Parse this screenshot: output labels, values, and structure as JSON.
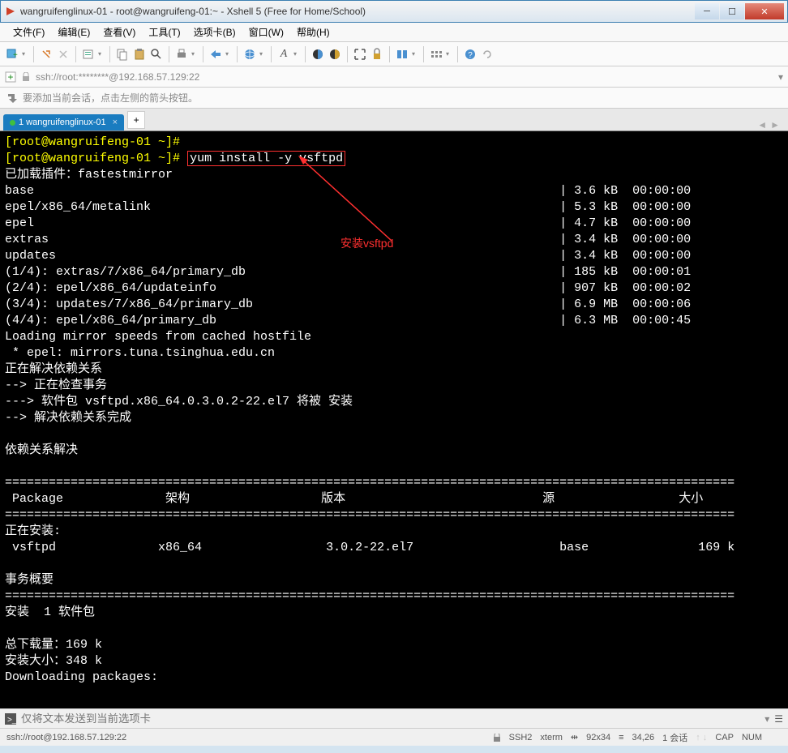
{
  "window": {
    "title": "wangruifenglinux-01 - root@wangruifeng-01:~ - Xshell 5 (Free for Home/School)"
  },
  "menu": {
    "file": "文件(F)",
    "edit": "编辑(E)",
    "view": "查看(V)",
    "tools": "工具(T)",
    "tab": "选项卡(B)",
    "window": "窗口(W)",
    "help": "帮助(H)"
  },
  "address": {
    "text": "ssh://root:********@192.168.57.129:22"
  },
  "info": {
    "text": "要添加当前会话，点击左侧的箭头按钮。"
  },
  "tab": {
    "label": "1 wangruifenglinux-01"
  },
  "terminal": {
    "prompt1": "[root@wangruifeng-01 ~]#",
    "prompt2": "[root@wangruifeng-01 ~]#",
    "command": "yum install -y vsftpd",
    "line_plugins": "已加载插件：fastestmirror",
    "repos": [
      {
        "name": "base",
        "size": "3.6 kB",
        "time": "00:00:00"
      },
      {
        "name": "epel/x86_64/metalink",
        "size": "5.3 kB",
        "time": "00:00:00"
      },
      {
        "name": "epel",
        "size": "4.7 kB",
        "time": "00:00:00"
      },
      {
        "name": "extras",
        "size": "3.4 kB",
        "time": "00:00:00"
      },
      {
        "name": "updates",
        "size": "3.4 kB",
        "time": "00:00:00"
      }
    ],
    "downloads": [
      {
        "idx": "(1/4): extras/7/x86_64/primary_db",
        "size": "185 kB",
        "time": "00:00:01"
      },
      {
        "idx": "(2/4): epel/x86_64/updateinfo",
        "size": "907 kB",
        "time": "00:00:02"
      },
      {
        "idx": "(3/4): updates/7/x86_64/primary_db",
        "size": "6.9 MB",
        "time": "00:00:06"
      },
      {
        "idx": "(4/4): epel/x86_64/primary_db",
        "size": "6.3 MB",
        "time": "00:00:45"
      }
    ],
    "loading_mirrors": "Loading mirror speeds from cached hostfile",
    "epel_mirror": " * epel: mirrors.tuna.tsinghua.edu.cn",
    "resolving": "正在解决依赖关系",
    "check_trans": "--> 正在检查事务",
    "pkg_install": "---> 软件包 vsftpd.x86_64.0.3.0.2-22.el7 将被 安装",
    "dep_done": "--> 解决依赖关系完成",
    "dep_resolved": "依赖关系解决",
    "hdr_package": " Package",
    "hdr_arch": "架构",
    "hdr_version": "版本",
    "hdr_repo": "源",
    "hdr_size": "大小",
    "installing": "正在安装:",
    "pkg_name": " vsftpd",
    "pkg_arch": "x86_64",
    "pkg_version": "3.0.2-22.el7",
    "pkg_repo": "base",
    "pkg_size": "169 k",
    "trans_summary": "事务概要",
    "install_count": "安装  1 软件包",
    "total_download": "总下载量：169 k",
    "install_size": "安装大小：348 k",
    "downloading_pkg": "Downloading packages:",
    "annotation": "安装vsftpd"
  },
  "inputbar": {
    "placeholder": "仅将文本发送到当前选项卡"
  },
  "status": {
    "conn": "ssh://root@192.168.57.129:22",
    "ssh": "SSH2",
    "term": "xterm",
    "size": "92x34",
    "pos": "34,26",
    "sessions": "1 会话",
    "cap": "CAP",
    "num": "NUM"
  }
}
